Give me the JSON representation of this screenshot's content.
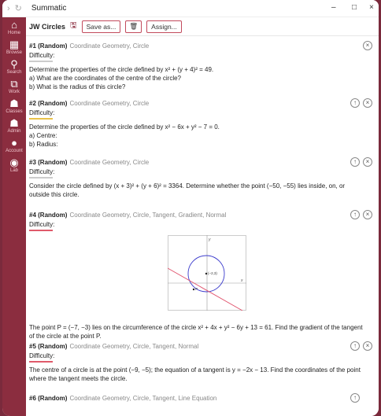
{
  "titlebar": {
    "app_title": "Summatic",
    "minimize": "–",
    "maximize": "□",
    "close": "×"
  },
  "sidebar": {
    "items": [
      {
        "label": "Home",
        "icon": "home-icon",
        "glyph": "⌂"
      },
      {
        "label": "Browse",
        "icon": "book-icon",
        "glyph": "▦"
      },
      {
        "label": "Search",
        "icon": "search-icon",
        "glyph": "⚲"
      },
      {
        "label": "Work",
        "icon": "work-icon",
        "glyph": "⧉"
      },
      {
        "label": "Classes",
        "icon": "classes-icon",
        "glyph": "☗"
      },
      {
        "label": "Admin",
        "icon": "admin-icon",
        "glyph": "☗"
      },
      {
        "label": "Account",
        "icon": "account-icon",
        "glyph": "●"
      },
      {
        "label": "Lab",
        "icon": "lab-icon",
        "glyph": "◉"
      }
    ]
  },
  "toolbar": {
    "doc_title": "JW Circles",
    "save_as": "Save as...",
    "assign": "Assign..."
  },
  "questions": [
    {
      "num": "#1 (Random)",
      "tags": "Coordinate Geometry, Circle",
      "difficulty": "Difficulty:",
      "diff_color": "#cccccc",
      "lines": [
        "Determine the properties of the circle defined by x² + (y + 4)² = 49.",
        "a) What are the coordinates of the centre of the circle?",
        "b) What is the radius of this circle?"
      ]
    },
    {
      "num": "#2 (Random)",
      "tags": "Coordinate Geometry, Circle",
      "difficulty": "Difficulty:",
      "diff_color": "#e9c24a",
      "lines": [
        "Determine the properties of the circle defined by x² − 6x + y² − 7 = 0.",
        "a) Centre:",
        "b) Radius:"
      ]
    },
    {
      "num": "#3 (Random)",
      "tags": "Coordinate Geometry, Circle",
      "difficulty": "Difficulty:",
      "diff_color": "#cccccc",
      "lines": [
        "Consider the circle defined by (x + 3)² + (y + 6)² = 3364. Determine whether the point (−50, −55) lies inside, on, or",
        "outside this circle."
      ]
    },
    {
      "num": "#4 (Random)",
      "tags": "Coordinate Geometry, Circle, Tangent, Gradient, Normal",
      "difficulty": "Difficulty:",
      "diff_color": "#e05a6a",
      "graph_labels": {
        "y": "y",
        "x": "x",
        "centre": "(−2,3)",
        "point": "P"
      },
      "lines": [
        "The point P = (−7, −3) lies on the circumference of the circle x² + 4x + y² − 6y + 13 = 61. Find the gradient of the tangent",
        "of the circle at the point P."
      ]
    },
    {
      "num": "#5 (Random)",
      "tags": "Coordinate Geometry, Circle, Tangent, Normal",
      "difficulty": "Difficulty:",
      "diff_color": "#e05a6a",
      "lines": [
        "The centre of a circle is at the point (−9, −5); the equation of a tangent is y = −2x − 13. Find the coordinates of the point",
        "where the tangent meets the circle."
      ]
    },
    {
      "num": "#6 (Random)",
      "tags": "Coordinate Geometry, Circle, Tangent, Line Equation"
    }
  ]
}
